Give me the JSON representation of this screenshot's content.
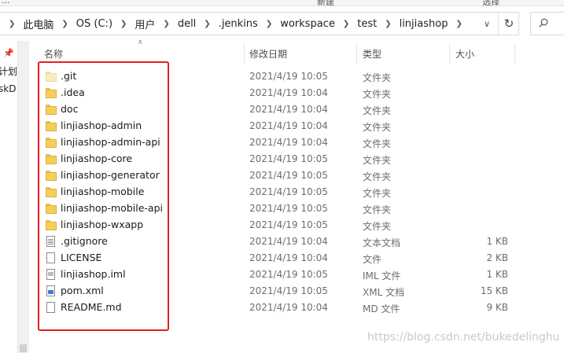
{
  "window": {
    "ribbon_labels": [
      "...",
      "新建",
      "选择"
    ]
  },
  "address": {
    "crumbs": [
      "此电脑",
      "OS (C:)",
      "用户",
      "dell",
      ".jenkins",
      "workspace",
      "test",
      "linjiashop"
    ]
  },
  "left_nav": {
    "items": [
      "计划",
      "skD"
    ]
  },
  "columns": {
    "name": "名称",
    "date": "修改日期",
    "type": "类型",
    "size": "大小"
  },
  "files": [
    {
      "name": ".git",
      "date": "2021/4/19 10:05",
      "type": "文件夹",
      "size": "",
      "icon": "folder-icon-faded"
    },
    {
      "name": ".idea",
      "date": "2021/4/19 10:04",
      "type": "文件夹",
      "size": "",
      "icon": "folder-icon"
    },
    {
      "name": "doc",
      "date": "2021/4/19 10:04",
      "type": "文件夹",
      "size": "",
      "icon": "folder-icon"
    },
    {
      "name": "linjiashop-admin",
      "date": "2021/4/19 10:04",
      "type": "文件夹",
      "size": "",
      "icon": "folder-icon"
    },
    {
      "name": "linjiashop-admin-api",
      "date": "2021/4/19 10:04",
      "type": "文件夹",
      "size": "",
      "icon": "folder-icon"
    },
    {
      "name": "linjiashop-core",
      "date": "2021/4/19 10:05",
      "type": "文件夹",
      "size": "",
      "icon": "folder-icon"
    },
    {
      "name": "linjiashop-generator",
      "date": "2021/4/19 10:05",
      "type": "文件夹",
      "size": "",
      "icon": "folder-icon"
    },
    {
      "name": "linjiashop-mobile",
      "date": "2021/4/19 10:05",
      "type": "文件夹",
      "size": "",
      "icon": "folder-icon"
    },
    {
      "name": "linjiashop-mobile-api",
      "date": "2021/4/19 10:05",
      "type": "文件夹",
      "size": "",
      "icon": "folder-icon"
    },
    {
      "name": "linjiashop-wxapp",
      "date": "2021/4/19 10:05",
      "type": "文件夹",
      "size": "",
      "icon": "folder-icon"
    },
    {
      "name": ".gitignore",
      "date": "2021/4/19 10:04",
      "type": "文本文档",
      "size": "1 KB",
      "icon": "text-file-icon"
    },
    {
      "name": "LICENSE",
      "date": "2021/4/19 10:04",
      "type": "文件",
      "size": "2 KB",
      "icon": "file-icon"
    },
    {
      "name": "linjiashop.iml",
      "date": "2021/4/19 10:05",
      "type": "IML 文件",
      "size": "1 KB",
      "icon": "iml-file-icon"
    },
    {
      "name": "pom.xml",
      "date": "2021/4/19 10:05",
      "type": "XML 文档",
      "size": "15 KB",
      "icon": "xml-file-icon"
    },
    {
      "name": "README.md",
      "date": "2021/4/19 10:04",
      "type": "MD 文件",
      "size": "9 KB",
      "icon": "file-icon"
    }
  ],
  "watermark": "https://blog.csdn.net/bukedelinghu",
  "colors": {
    "highlight": "#e02020",
    "folder": "#f5cf57"
  }
}
